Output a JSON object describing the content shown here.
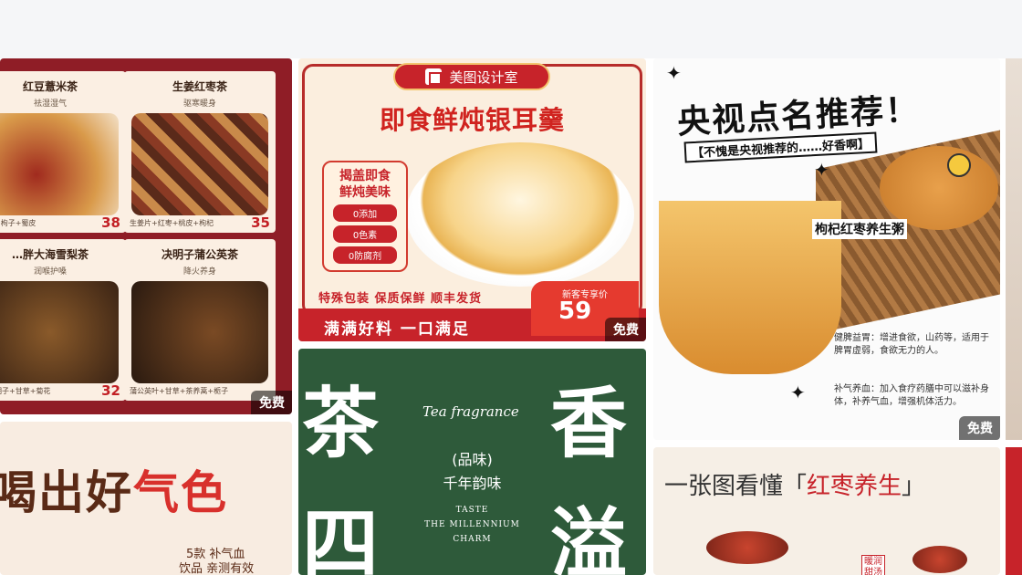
{
  "cards": {
    "c1": {
      "tiles": [
        {
          "title": "红豆薏米茶",
          "subtitle": "祛湿湿气",
          "footer": "…皮+枸子+蜀皮",
          "price": "38",
          "color": "#b84a2e"
        },
        {
          "title": "生姜红枣茶",
          "subtitle": "驱寒暖身",
          "footer": "生姜片+红枣+桃皮+枸杞",
          "price": "35",
          "color": "#5a2a1a"
        },
        {
          "title": "…胖大海雪梨茶",
          "subtitle": "润喉护嗓",
          "footer": "…决明子+甘草+菊花",
          "price": "32",
          "color": "#6b3d1a"
        },
        {
          "title": "决明子蒲公英茶",
          "subtitle": "降火养身",
          "footer": "蒲公英叶+甘草+茶养蒿+栀子",
          "price": "",
          "color": "#3a2314"
        }
      ],
      "badge": "免费"
    },
    "c2": {
      "brand": "美图设计室",
      "title": "即食鲜炖银耳羹",
      "side_head": "揭盖即食\n鲜炖美味",
      "tags": [
        "0添加",
        "0色素",
        "0防腐剂"
      ],
      "features": "特殊包装 保质保鲜 顺丰发货",
      "bottom": "满满好料 一口满足",
      "price_label": "新客专享价",
      "price": "59",
      "badge": "免费"
    },
    "c3": {
      "headline": "央视点名推荐！",
      "sub": "【不愧是央视推荐的……好香啊】",
      "label": "枸杞红枣养生粥",
      "notes": [
        "健脾益胃：增进食欲，山药等，适用于脾胃虚弱，食欲无力的人。",
        "补气养血：加入食疗药膳中可以滋补身体，补养气血，增强机体活力。"
      ],
      "badge": "免费"
    },
    "c4": {
      "headline_a": "喝出好",
      "headline_b": "气色",
      "sub1": "5款 补气血",
      "sub2": "饮品 亲测有效"
    },
    "c5": {
      "ch1": "茶",
      "ch2": "香",
      "ch3": "四",
      "ch4": "溢",
      "en": "Tea fragrance",
      "line1": "(品味)",
      "line2": "千年韵味",
      "cap1": "TASTE",
      "cap2": "THE MILLENNIUM",
      "cap3": "CHARM"
    },
    "c6": {
      "title_a": "一张图看懂「",
      "title_b": "红枣养生",
      "title_c": "」",
      "tag": "暖润\n甜汤"
    }
  },
  "colors": {
    "accent": "#c7232a",
    "topbar": "#f5f6f8"
  }
}
